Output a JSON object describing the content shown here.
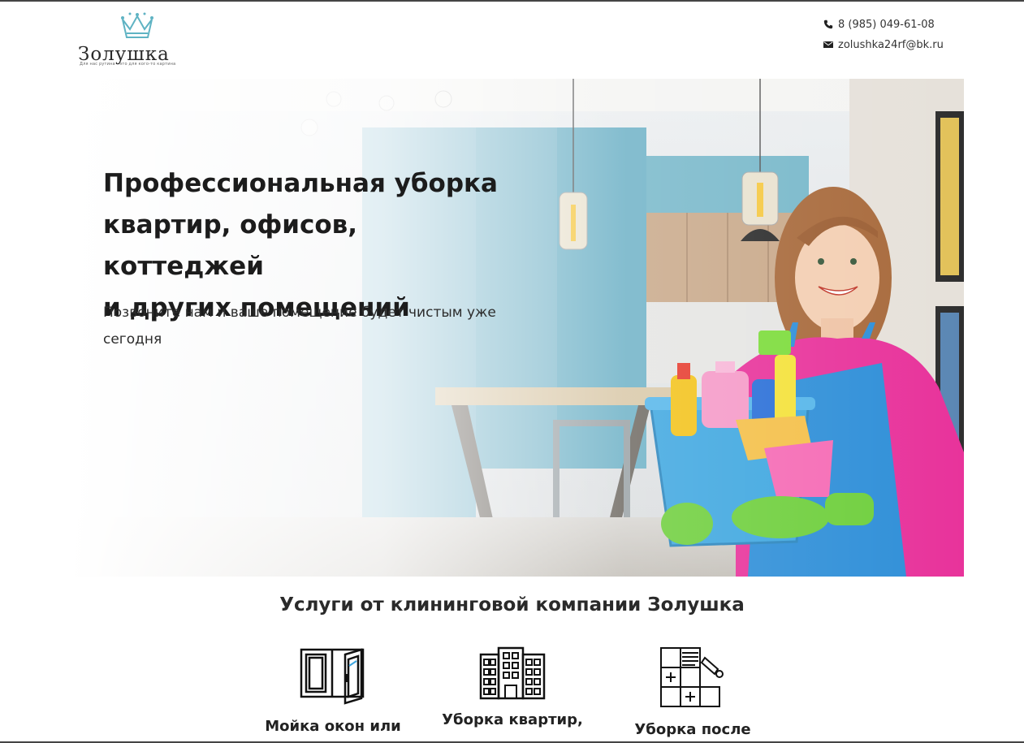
{
  "header": {
    "brand": "Золушка",
    "slogan": "Для нас рутина - это для кого-то картина",
    "phone": "8 (985) 049-61-08",
    "email": "zolushka24rf@bk.ru"
  },
  "hero": {
    "title_line1": "Профессиональная уборка",
    "title_line2": "квартир, офисов, коттеджей",
    "title_line3": "и других помещений",
    "subtitle_line1": "Позвоните нам и ваше помещение будет чистым уже",
    "subtitle_line2": "сегодня"
  },
  "services": {
    "title": "Услуги от клининговой компании Золушка",
    "items": [
      {
        "label": "Мойка окон или",
        "icon": "window-icon"
      },
      {
        "label": "Уборка квартир,",
        "icon": "building-icon"
      },
      {
        "label": "Уборка после",
        "icon": "renovation-icon"
      }
    ]
  },
  "colors": {
    "crown": "#5fb3c3",
    "apron": "#2f8fd8",
    "shirt": "#e8339b",
    "glove": "#6fcf3d",
    "kitchen_blue": "#7fb9cc"
  }
}
